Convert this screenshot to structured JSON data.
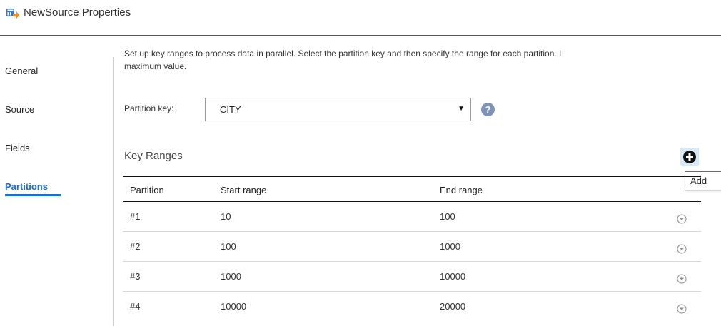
{
  "header": {
    "title": "NewSource Properties",
    "icon": "source-transformation-icon"
  },
  "sidebar": {
    "items": [
      {
        "label": "General",
        "active": false
      },
      {
        "label": "Source",
        "active": false
      },
      {
        "label": "Fields",
        "active": false
      },
      {
        "label": "Partitions",
        "active": true
      }
    ]
  },
  "main": {
    "description_line1": "Set up key ranges to process data in parallel. Select the partition key and then specify the range for each partition. I",
    "description_line2": "maximum value.",
    "partition_key": {
      "label": "Partition key:",
      "value": "CITY"
    },
    "key_ranges": {
      "title": "Key Ranges",
      "add_tooltip": "Add",
      "columns": [
        "Partition",
        "Start range",
        "End range"
      ],
      "rows": [
        {
          "partition": "#1",
          "start": "10",
          "end": "100"
        },
        {
          "partition": "#2",
          "start": "100",
          "end": "1000"
        },
        {
          "partition": "#3",
          "start": "1000",
          "end": "10000"
        },
        {
          "partition": "#4",
          "start": "10000",
          "end": "20000"
        }
      ]
    }
  },
  "colors": {
    "accent": "#1a6fc4",
    "help_icon": "#7e93b5",
    "add_highlight": "#d7e9f7"
  }
}
